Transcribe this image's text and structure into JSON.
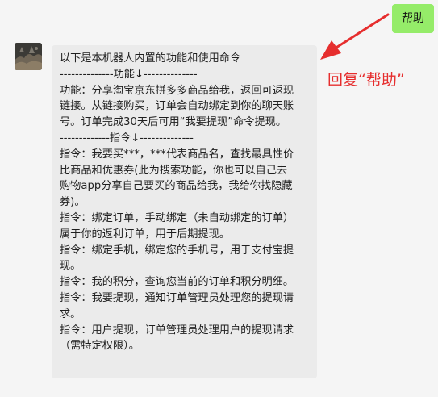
{
  "outgoing_message": {
    "text": "帮助"
  },
  "incoming_message": {
    "lines": [
      "以下是本机器人内置的功能和使用命令",
      "--------------功能↓--------------",
      "功能：分享淘宝京东拼多多商品给我，返回可返现",
      "链接。从链接购买，订单会自动绑定到你的聊天账",
      "号。订单完成30天后可用“我要提现”命令提现。",
      "-------------指令↓--------------",
      "指令：我要买***，***代表商品名，查找最具性价",
      "比商品和优惠券(此为搜索功能，你也可以自己去",
      "购物app分享自己要买的商品给我，我给你找隐藏",
      "券)。",
      "指令：绑定订单，手动绑定（未自动绑定的订单）",
      "属于你的返利订单，用于后期提现。",
      "指令：绑定手机，绑定您的手机号，用于支付宝提",
      "现。",
      "指令：我的积分，查询您当前的订单和积分明细。",
      "指令：我要提现，通知订单管理员处理您的提现请",
      "求。",
      "指令：用户提现，订单管理员处理用户的提现请求",
      "（需特定权限）。"
    ]
  },
  "annotation": {
    "label": "回复“帮助”",
    "color": "#e62e2e"
  },
  "colors": {
    "background": "#f5f5f5",
    "outgoing_bubble": "#95ec69",
    "incoming_bubble": "#ebebeb"
  }
}
